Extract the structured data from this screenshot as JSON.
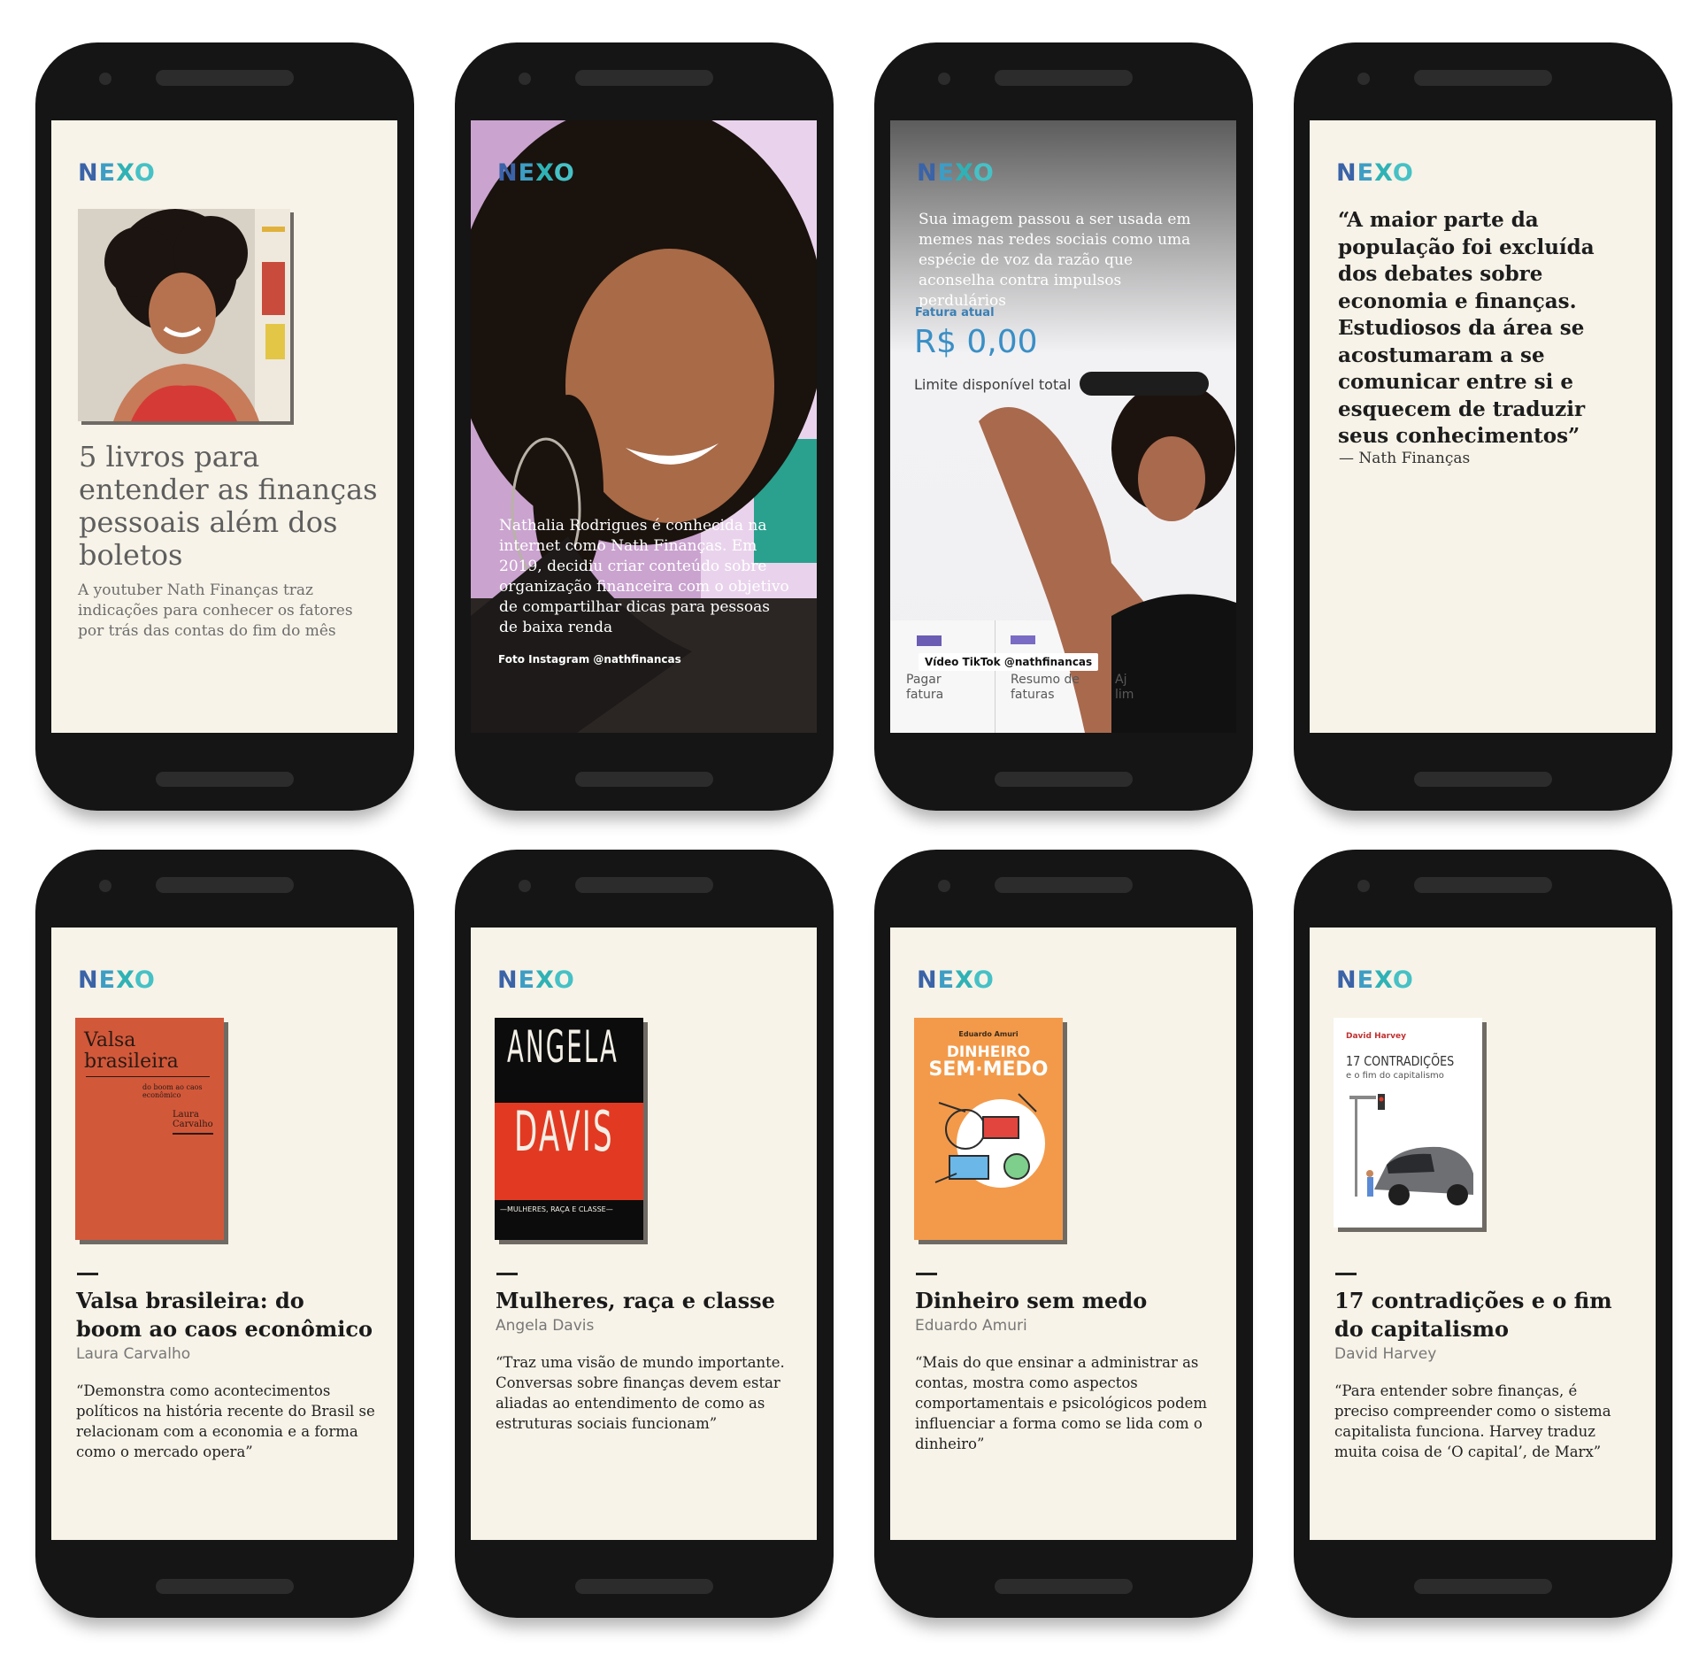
{
  "brand": {
    "letters": [
      "N",
      "E",
      "X",
      "O"
    ]
  },
  "screen1": {
    "title": "5 livros para entender as finanças pessoais além dos boletos",
    "dek": "A youtuber Nath Finanças traz indicações para conhecer os fatores por trás das contas do fim do mês"
  },
  "screen2": {
    "caption": "Nathalia Rodrigues é conhecida na internet como Nath Finanças. Em 2019, decidiu criar conteúdo sobre organização financeira com o objetivo de compartilhar dicas para pessoas de baixa renda",
    "credit": "Foto Instagram @nathfinancas"
  },
  "screen3": {
    "caption": "Sua imagem passou a ser usada em memes nas redes sociais como uma espécie de voz da razão que aconselha contra impulsos perdulários",
    "fatura_label": "Fatura atual",
    "fatura_value": "R$ 0,00",
    "limite": "Limite disponível total",
    "action1": "Pagar fatura",
    "action2": "Resumo de faturas",
    "action3": "Aj lim",
    "credit": "Vídeo TikTok @nathfinancas"
  },
  "screen4": {
    "quote": "“A maior parte da população foi excluída dos debates sobre economia e finanças. Estudiosos da área se acostumaram a se comunicar entre si e esquecem de traduzir seus conhecimentos”",
    "attribution": "— Nath Finanças"
  },
  "books": [
    {
      "title": "Valsa brasileira: do boom ao caos econômico",
      "author": "Laura Carvalho",
      "quote": "“Demonstra como acontecimentos políticos na história recente do Brasil se relacionam com a economia e a forma como o mercado opera”",
      "cover": {
        "title": "Valsa brasileira",
        "subtitle": "do boom ao caos econômico",
        "author": "Laura Carvalho",
        "color": "#d2583a"
      }
    },
    {
      "title": "Mulheres, raça e classe",
      "author": "Angela Davis",
      "quote": "“Traz uma visão de mundo importante. Conversas sobre finanças devem estar aliadas ao entendimento de como as estruturas sociais funcionam”",
      "cover": {
        "line1": "ANGELA",
        "line2": "DAVIS",
        "subtitle": "—MULHERES, RAÇA E CLASSE—",
        "color": "#e23a22"
      }
    },
    {
      "title": "Dinheiro sem medo",
      "author": "Eduardo Amuri",
      "quote": "“Mais do que ensinar a administrar as contas, mostra como aspectos comportamentais e psicológicos podem influenciar a forma como se lida com o dinheiro”",
      "cover": {
        "author": "Eduardo Amuri",
        "line1": "DINHEIRO",
        "line2": "SEM·MEDO",
        "color": "#f39a4a"
      }
    },
    {
      "title": "17 contradições e o fim do capitalismo",
      "author": "David Harvey",
      "quote": "“Para entender sobre finanças, é preciso compreender como o sistema capitalista funciona. Harvey traduz muita coisa de ‘O capital’, de Marx”",
      "cover": {
        "author": "David Harvey",
        "line1": "17 CONTRADIÇÕES",
        "line2": "e o fim do capitalismo",
        "color": "#ffffff"
      }
    }
  ]
}
